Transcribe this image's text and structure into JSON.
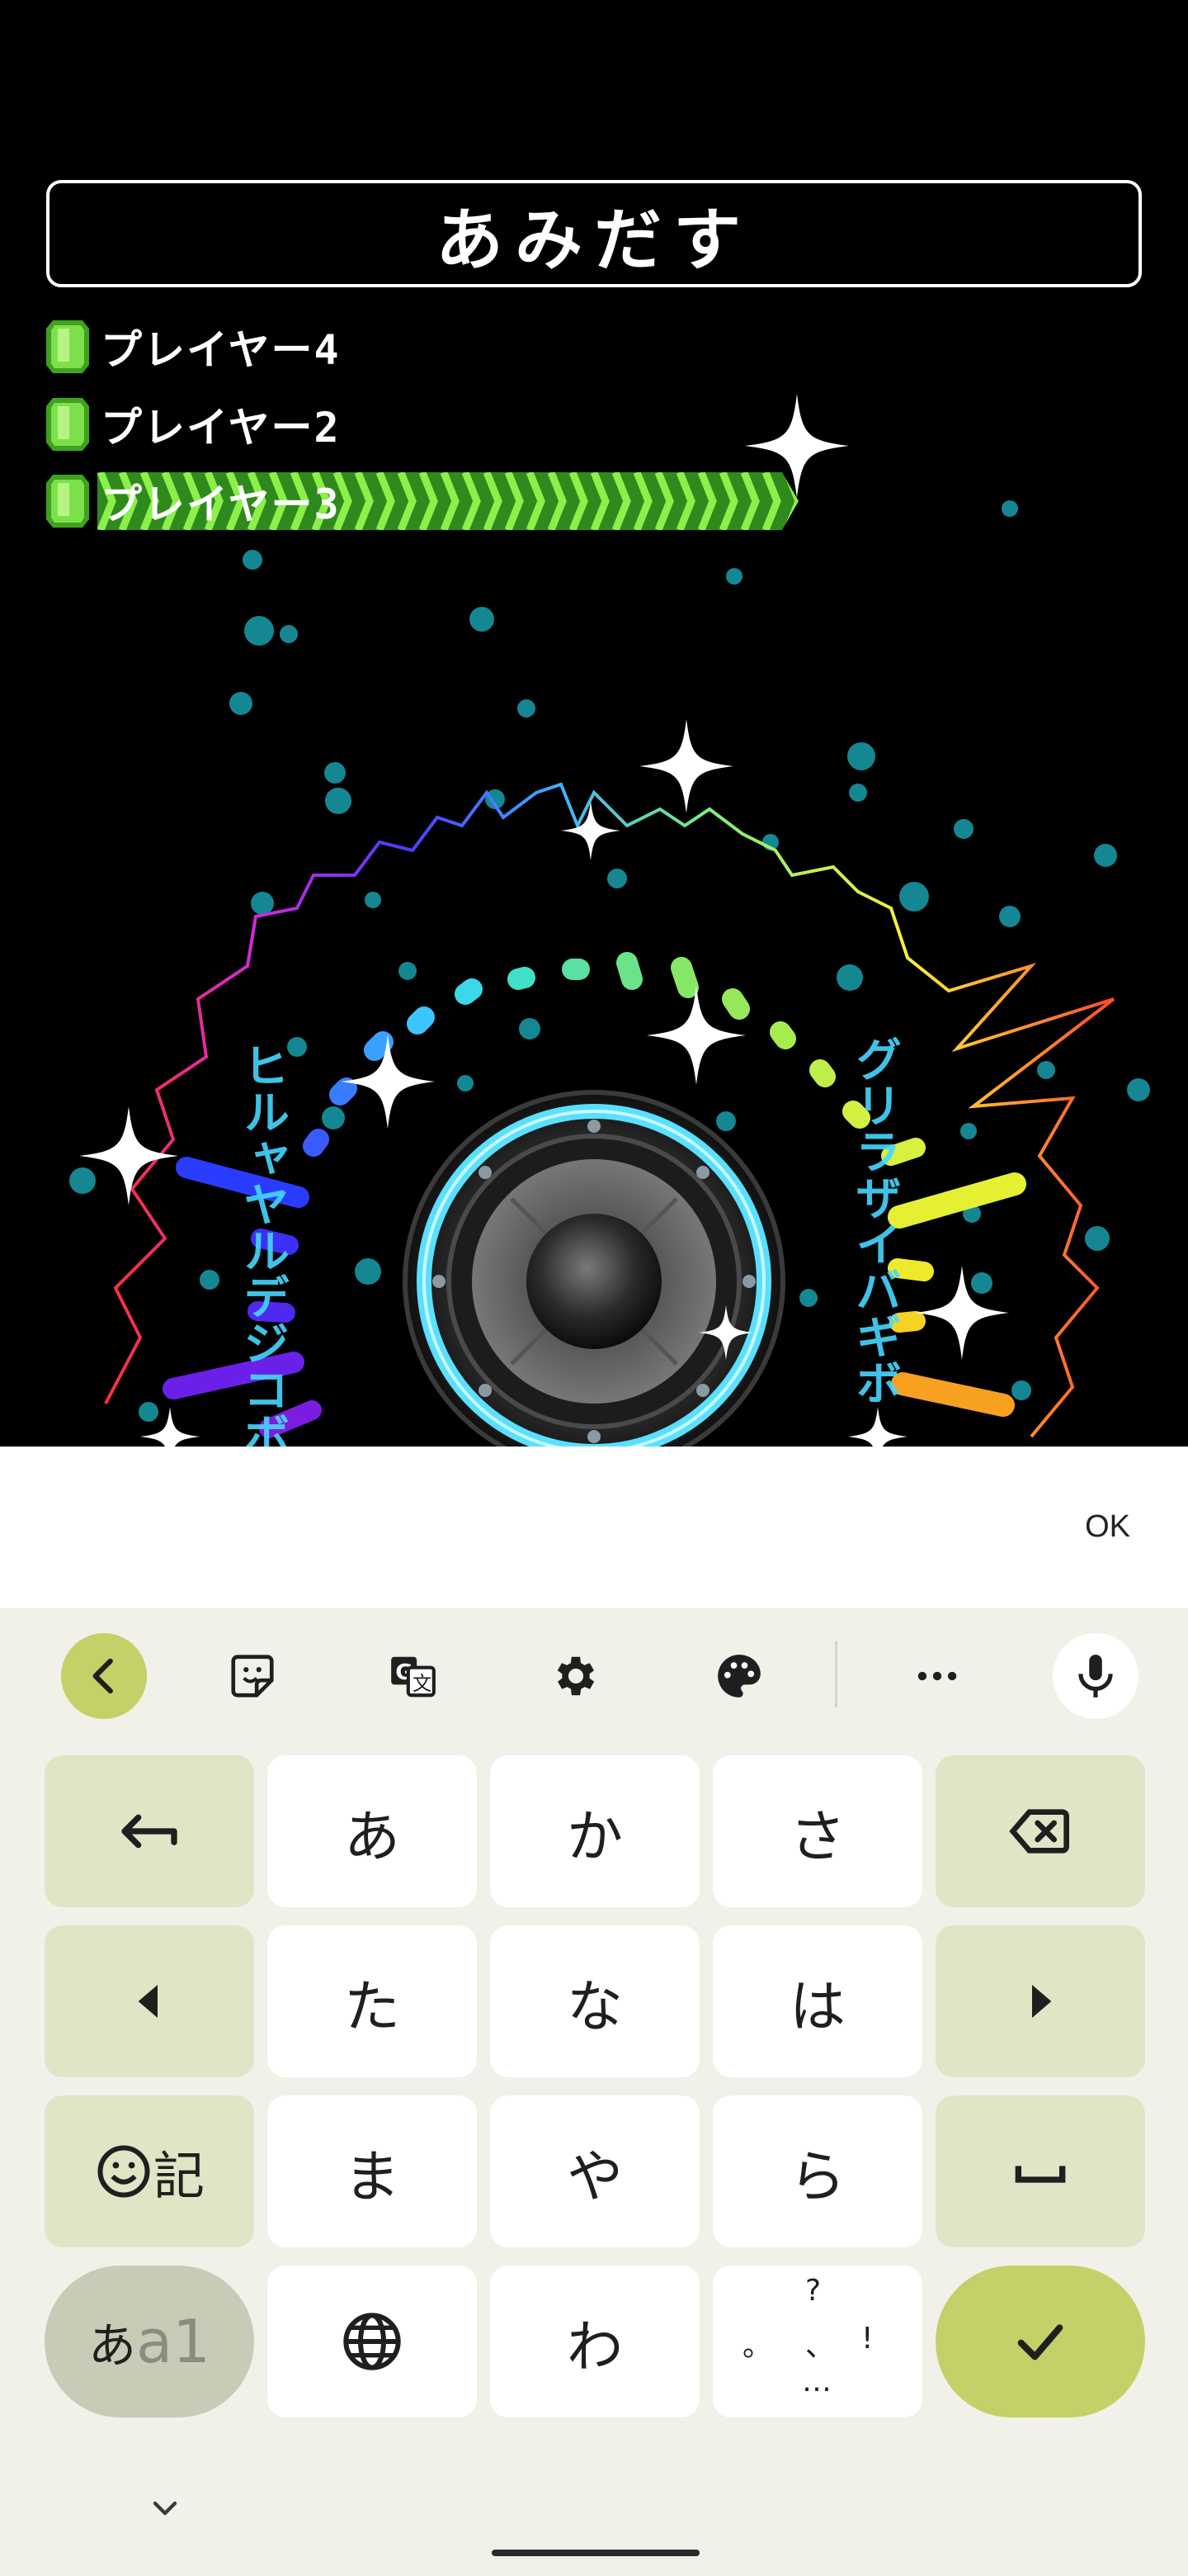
{
  "game": {
    "title": "あみだす",
    "players": [
      {
        "name": "プレイヤー4"
      },
      {
        "name": "プレイヤー2"
      },
      {
        "name": "プレイヤー3"
      }
    ],
    "left_vertical_text": "ヒルャヤルデジコボイス",
    "right_vertical_text": "グリラザイバギボ"
  },
  "input": {
    "ok_label": "OK"
  },
  "keyboard": {
    "toolbar": {
      "back_icon": "chevron-left-icon",
      "sticker_icon": "sticker-icon",
      "translate_icon": "translate-icon",
      "settings_icon": "gear-icon",
      "theme_icon": "palette-icon",
      "more_icon": "more-horizontal-icon",
      "mic_icon": "microphone-icon"
    },
    "rows": [
      [
        "あ",
        "か",
        "さ"
      ],
      [
        "た",
        "な",
        "は"
      ],
      [
        "ま",
        "や",
        "ら"
      ],
      [
        "わ"
      ]
    ],
    "emoji_symbol_label": "記",
    "mode_label_kana": "あ",
    "mode_label_alpha": "a1",
    "punct_keys": [
      "?",
      "。",
      "、",
      "!",
      "…"
    ],
    "accent_color": "#c3d168",
    "fn_key_color": "#e1e5c6"
  }
}
